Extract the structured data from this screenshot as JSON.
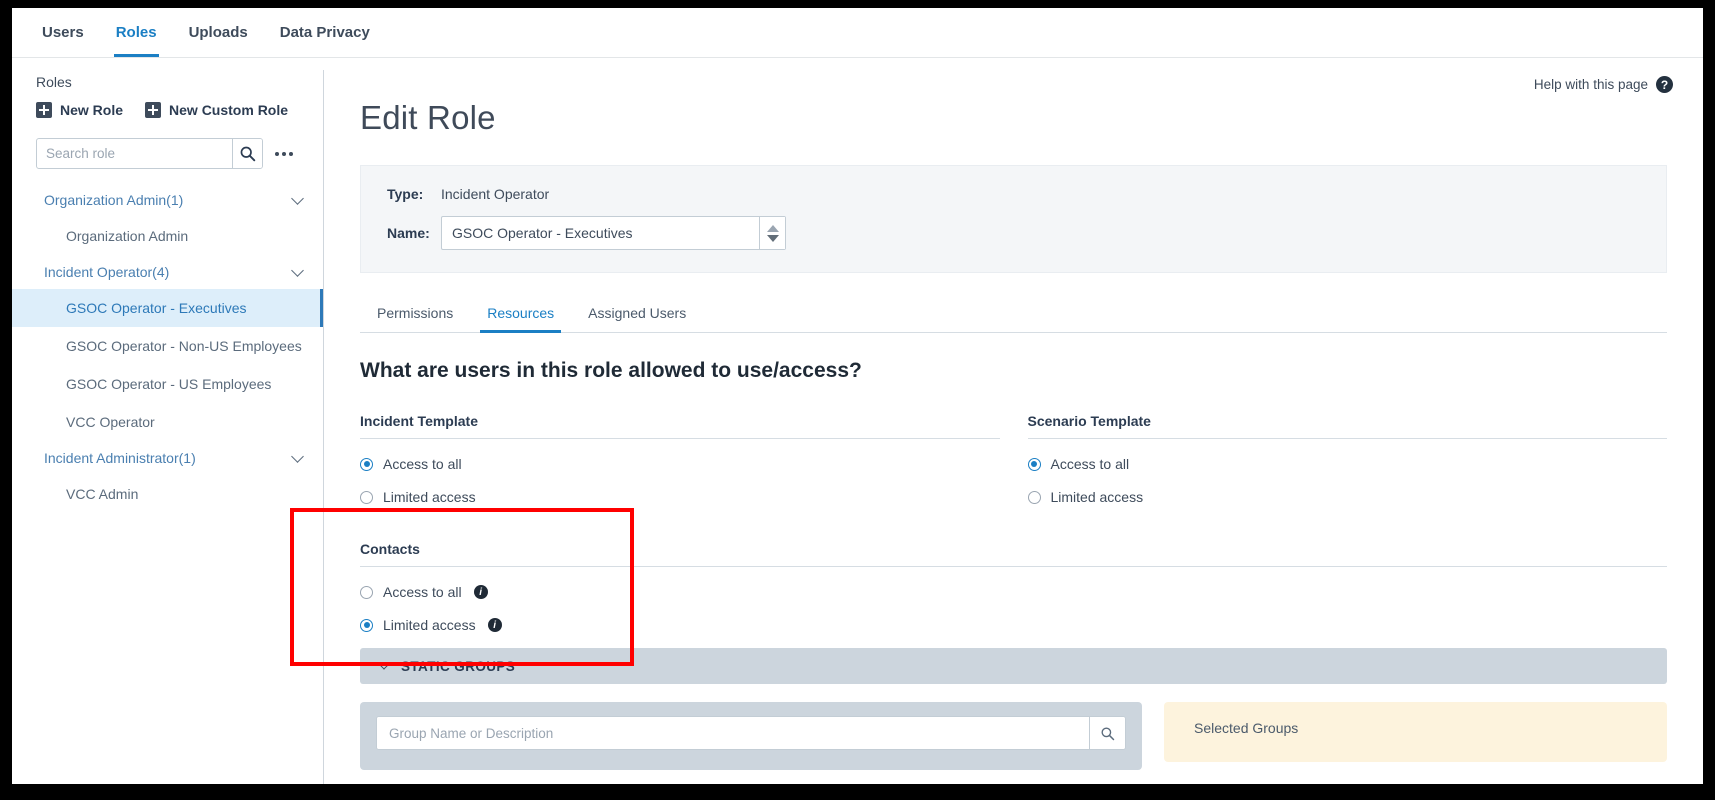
{
  "topnav": {
    "items": [
      {
        "label": "Users",
        "active": false
      },
      {
        "label": "Roles",
        "active": true
      },
      {
        "label": "Uploads",
        "active": false
      },
      {
        "label": "Data Privacy",
        "active": false
      }
    ]
  },
  "sidebar": {
    "title": "Roles",
    "new_role_label": "New Role",
    "new_custom_role_label": "New Custom Role",
    "search": {
      "placeholder": "Search role",
      "value": "",
      "icon": "search-icon"
    },
    "more_icon": "more-options-icon",
    "tree": [
      {
        "label": "Organization Admin(1)",
        "type": "group",
        "expanded": true
      },
      {
        "label": "Organization Admin",
        "type": "child",
        "selected": false
      },
      {
        "label": "Incident Operator(4)",
        "type": "group",
        "expanded": true
      },
      {
        "label": "GSOC Operator - Executives",
        "type": "child",
        "selected": true
      },
      {
        "label": "GSOC Operator - Non-US Employees",
        "type": "child",
        "selected": false
      },
      {
        "label": "GSOC Operator - US Employees",
        "type": "child",
        "selected": false
      },
      {
        "label": "VCC Operator",
        "type": "child",
        "selected": false
      },
      {
        "label": "Incident Administrator(1)",
        "type": "group",
        "expanded": true
      },
      {
        "label": "VCC Admin",
        "type": "child",
        "selected": false
      }
    ]
  },
  "main": {
    "help_label": "Help with this page",
    "help_icon": "question-mark-icon",
    "page_title": "Edit Role",
    "info": {
      "type_label": "Type:",
      "type_value": "Incident Operator",
      "name_label": "Name:",
      "name_value": "GSOC Operator - Executives"
    },
    "tabs": [
      {
        "label": "Permissions",
        "active": false
      },
      {
        "label": "Resources",
        "active": true
      },
      {
        "label": "Assigned Users",
        "active": false
      }
    ],
    "question": "What are users in this role allowed to use/access?",
    "incident_template": {
      "heading": "Incident Template",
      "options": [
        {
          "label": "Access to all",
          "selected": true,
          "info": false
        },
        {
          "label": "Limited access",
          "selected": false,
          "info": false
        }
      ]
    },
    "scenario_template": {
      "heading": "Scenario Template",
      "options": [
        {
          "label": "Access to all",
          "selected": true,
          "info": false
        },
        {
          "label": "Limited access",
          "selected": false,
          "info": false
        }
      ]
    },
    "contacts": {
      "heading": "Contacts",
      "options": [
        {
          "label": "Access to all",
          "selected": false,
          "info": true
        },
        {
          "label": "Limited access",
          "selected": true,
          "info": true
        }
      ],
      "accordion_label": "STATIC GROUPS",
      "accordion_icon": "chevron-down-icon"
    },
    "group_search": {
      "placeholder": "Group Name or Description",
      "value": "",
      "icon": "search-icon"
    },
    "selected_groups_label": "Selected Groups"
  },
  "colors": {
    "accent": "#1b7fc4",
    "annotation": "#ff0000",
    "selected_row": "#ddeefa",
    "panel_gray": "#ccd5dd",
    "panel_cream": "#fdf3dd"
  }
}
